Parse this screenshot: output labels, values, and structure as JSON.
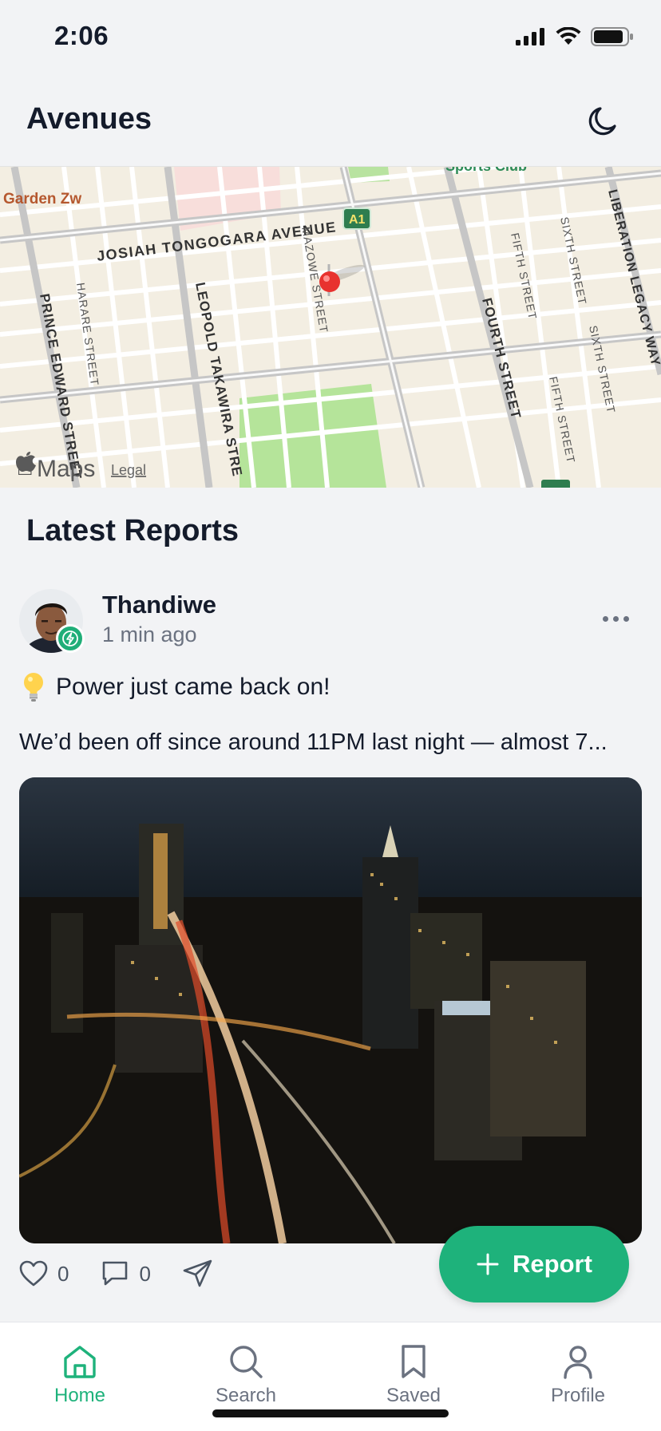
{
  "status": {
    "time": "2:06"
  },
  "header": {
    "title": "Avenues",
    "theme_icon": "moon-icon"
  },
  "map": {
    "labels": {
      "garden": "Garden Zw",
      "josiah": "JOSIAH TONGOGARA AVENUE",
      "a1": "A1",
      "sports": "Sports Club",
      "mazowe": "MAZOWE STREET",
      "harare": "HARARE STREET",
      "prince": "PRINCE EDWARD STREET",
      "leopold": "LEOPOLD TAKAWIRA STRE",
      "fourth": "FOURTH STREET",
      "fifth1": "FIFTH STREET",
      "fifth2": "FIFTH STREET",
      "sixth1": "SIXTH STREET",
      "sixth2": "SIXTH STREET",
      "liberation": "LIBERATION LEGACY WAY",
      "maps": "Maps",
      "legal": "Legal"
    },
    "pin_color": "#e8322f"
  },
  "feed": {
    "section_title": "Latest Reports",
    "post": {
      "author": "Thandiwe",
      "time_ago": "1 min ago",
      "headline": "Power just came back on!",
      "headline_icon": "lightbulb-icon",
      "body": "We’d been off since around 11PM last night — almost 7...",
      "likes": "0",
      "comments": "0"
    }
  },
  "fab": {
    "label": "Report"
  },
  "tabs": [
    {
      "label": "Home",
      "icon": "home-icon",
      "active": true
    },
    {
      "label": "Search",
      "icon": "search-icon",
      "active": false
    },
    {
      "label": "Saved",
      "icon": "bookmark-icon",
      "active": false
    },
    {
      "label": "Profile",
      "icon": "profile-icon",
      "active": false
    }
  ],
  "colors": {
    "accent": "#1eb27b",
    "text": "#141b2b",
    "background": "#f2f3f5"
  }
}
